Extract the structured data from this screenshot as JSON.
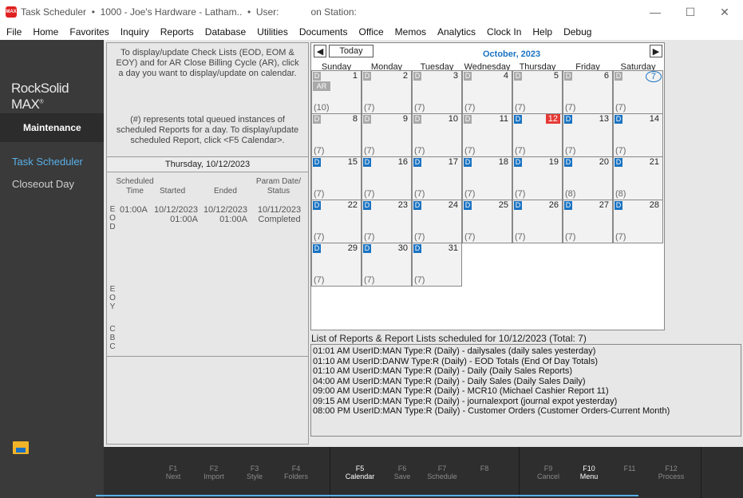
{
  "titlebar": {
    "app_icon_text": "MAX",
    "title": "Task Scheduler  •  1000 - Joe's Hardware - Latham..  •  User:            on Station:",
    "minimize_label": "—",
    "maximize_label": "☐",
    "close_label": "✕"
  },
  "menu": [
    "File",
    "Home",
    "Favorites",
    "Inquiry",
    "Reports",
    "Database",
    "Utilities",
    "Documents",
    "Office",
    "Memos",
    "Analytics",
    "Clock In",
    "Help",
    "Debug"
  ],
  "sidebar": {
    "brand": "RockSolid MAX",
    "brand_mark": "®",
    "section": "Maintenance",
    "items": [
      "Task Scheduler",
      "Closeout Day"
    ],
    "active_color": "#5ab0e8",
    "item_color": "#d0d0d0"
  },
  "left_panel": {
    "info1": [
      "To display/update Check Lists (EOD, EOM &",
      "EOY) and for AR Close Billing Cycle (AR), click",
      "a day you want to display/update on calendar."
    ],
    "info2": [
      "(#) represents total queued instances of",
      "scheduled Reports for a day.  To display/update",
      "scheduled Report, click <F5 Calendar>."
    ],
    "day_header": "Thursday, 10/12/2023",
    "columns": {
      "scheduled_1": "Scheduled",
      "scheduled_2": "Time",
      "started": "Started",
      "ended": "Ended",
      "param_1": "Param Date/",
      "param_2": "Status"
    },
    "eod": {
      "letters": [
        "E",
        "O",
        "D"
      ],
      "time": "01:00A",
      "started_1": "10/12/2023",
      "started_2": "01:00A",
      "ended_1": "10/12/2023",
      "ended_2": "01:00A",
      "param": "10/11/2023",
      "status": "Completed"
    },
    "eoy_letters": [
      "E",
      "O",
      "Y"
    ],
    "cbc_letters": [
      "C",
      "B",
      "C"
    ]
  },
  "calendar": {
    "prev_label": "◀",
    "today_label": "Today",
    "next_label": "▶",
    "month": "October, 2023",
    "weekdays": [
      "Sunday",
      "Monday",
      "Tuesday",
      "Wednesday",
      "Thursday",
      "Friday",
      "Saturday"
    ],
    "weeks": [
      [
        {
          "n": "1",
          "b": "D",
          "c": "grey",
          "q": "(10)",
          "ar": "AR"
        },
        {
          "n": "2",
          "b": "D",
          "c": "grey",
          "q": "(7)"
        },
        {
          "n": "3",
          "b": "D",
          "c": "grey",
          "q": "(7)"
        },
        {
          "n": "4",
          "b": "D",
          "c": "grey",
          "q": "(7)"
        },
        {
          "n": "5",
          "b": "D",
          "c": "grey",
          "q": "(7)"
        },
        {
          "n": "6",
          "b": "D",
          "c": "grey",
          "q": "(7)"
        },
        {
          "n": "7",
          "b": "D",
          "c": "grey",
          "q": "(7)",
          "sel": true
        }
      ],
      [
        {
          "n": "8",
          "b": "D",
          "c": "grey",
          "q": "(7)"
        },
        {
          "n": "9",
          "b": "D",
          "c": "grey",
          "q": "(7)"
        },
        {
          "n": "10",
          "b": "D",
          "c": "grey",
          "q": "(7)"
        },
        {
          "n": "11",
          "b": "D",
          "c": "grey",
          "q": "(7)"
        },
        {
          "n": "12",
          "b": "D",
          "c": "blue",
          "q": "(7)",
          "today": true
        },
        {
          "n": "13",
          "b": "D",
          "c": "blue",
          "q": "(7)"
        },
        {
          "n": "14",
          "b": "D",
          "c": "blue",
          "q": "(7)"
        }
      ],
      [
        {
          "n": "15",
          "b": "D",
          "c": "blue",
          "q": "(7)"
        },
        {
          "n": "16",
          "b": "D",
          "c": "blue",
          "q": "(7)"
        },
        {
          "n": "17",
          "b": "D",
          "c": "blue",
          "q": "(7)"
        },
        {
          "n": "18",
          "b": "D",
          "c": "blue",
          "q": "(7)"
        },
        {
          "n": "19",
          "b": "D",
          "c": "blue",
          "q": "(7)"
        },
        {
          "n": "20",
          "b": "D",
          "c": "blue",
          "q": "(8)"
        },
        {
          "n": "21",
          "b": "D",
          "c": "blue",
          "q": "(8)"
        }
      ],
      [
        {
          "n": "22",
          "b": "D",
          "c": "blue",
          "q": "(7)"
        },
        {
          "n": "23",
          "b": "D",
          "c": "blue",
          "q": "(7)"
        },
        {
          "n": "24",
          "b": "D",
          "c": "blue",
          "q": "(7)"
        },
        {
          "n": "25",
          "b": "D",
          "c": "blue",
          "q": "(7)"
        },
        {
          "n": "26",
          "b": "D",
          "c": "blue",
          "q": "(7)"
        },
        {
          "n": "27",
          "b": "D",
          "c": "blue",
          "q": "(7)"
        },
        {
          "n": "28",
          "b": "D",
          "c": "blue",
          "q": "(7)"
        }
      ],
      [
        {
          "n": "29",
          "b": "D",
          "c": "blue",
          "q": "(7)"
        },
        {
          "n": "30",
          "b": "D",
          "c": "blue",
          "q": "(7)"
        },
        {
          "n": "31",
          "b": "D",
          "c": "blue",
          "q": "(7)"
        }
      ]
    ]
  },
  "report_list": {
    "title": "List of Reports & Report Lists scheduled for 10/12/2023  (Total: 7)",
    "rows": [
      "01:01 AM  UserID:MAN  Type:R  (Daily) - dailysales (daily sales yesterday)",
      "01:10 AM  UserID:DANW  Type:R  (Daily) - EOD Totals (End Of Day Totals)",
      "01:10 AM  UserID:MAN  Type:R  (Daily) - Daily (Daily Sales Reports)",
      "04:00 AM  UserID:MAN  Type:R  (Daily) - Daily Sales (Daily Sales Daily)",
      "09:00 AM  UserID:MAN  Type:R  (Daily) - MCR10 (Michael Cashier Report 11)",
      "09:15 AM  UserID:MAN  Type:R  (Daily) - journalexport (journal expot yesterday)",
      "08:00 PM  UserID:MAN  Type:R  (Daily) - Customer Orders (Customer Orders-Current Month)"
    ]
  },
  "fkeys": [
    {
      "key": "F1",
      "label": "Next",
      "active": false
    },
    {
      "key": "F2",
      "label": "Import",
      "active": false
    },
    {
      "key": "F3",
      "label": "Style",
      "active": false
    },
    {
      "key": "F4",
      "label": "Folders",
      "active": false
    },
    {
      "key": "F5",
      "label": "Calendar",
      "active": true
    },
    {
      "key": "F6",
      "label": "Save",
      "active": false
    },
    {
      "key": "F7",
      "label": "Schedule",
      "active": false
    },
    {
      "key": "F8",
      "label": "",
      "active": false
    },
    {
      "key": "F9",
      "label": "Cancel",
      "active": false
    },
    {
      "key": "F10",
      "label": "Menu",
      "active": true
    },
    {
      "key": "F11",
      "label": "",
      "active": false
    },
    {
      "key": "F12",
      "label": "Process",
      "active": false
    }
  ]
}
